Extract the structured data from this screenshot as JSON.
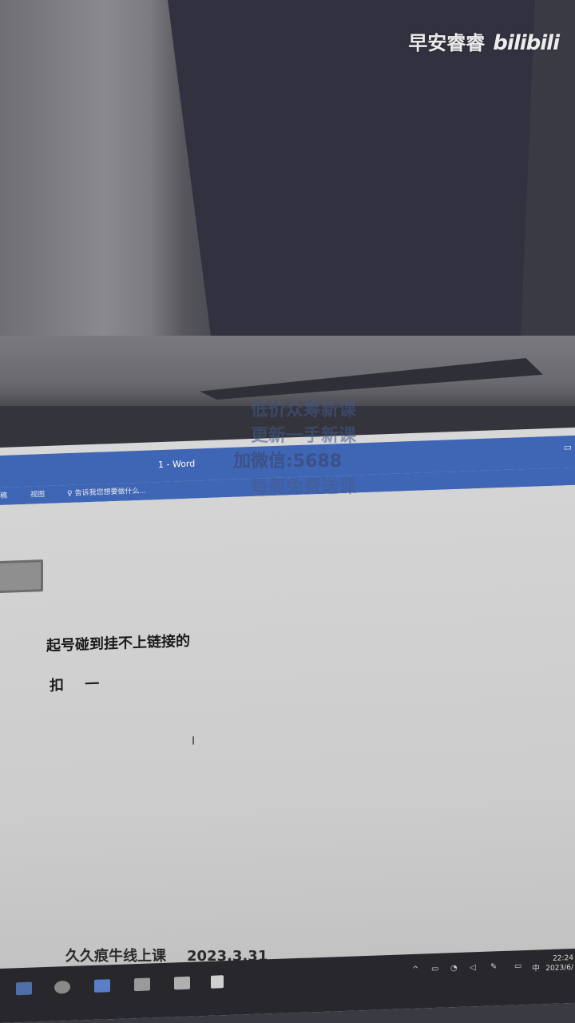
{
  "watermark": {
    "channel": "早安睿睿",
    "brand": "bilibili"
  },
  "window": {
    "title": "1 - Word",
    "ribbon_tabs": [
      "稿",
      "视图"
    ],
    "tell_me_placeholder": "♀ 告诉我您想要做什么..."
  },
  "document": {
    "line1": "起号碰到挂不上链接的",
    "line2": "扣 一"
  },
  "promo": {
    "line1": "低价众筹新课",
    "line2": "更新一手新课",
    "line3": "加微信:5688",
    "line4": "每周免费送课"
  },
  "caption": {
    "text": "久久痕牛线上课",
    "date": "2023.3.31"
  },
  "taskbar": {
    "clock_time": "22:24",
    "clock_date": "2023/6/",
    "ime": "中"
  }
}
